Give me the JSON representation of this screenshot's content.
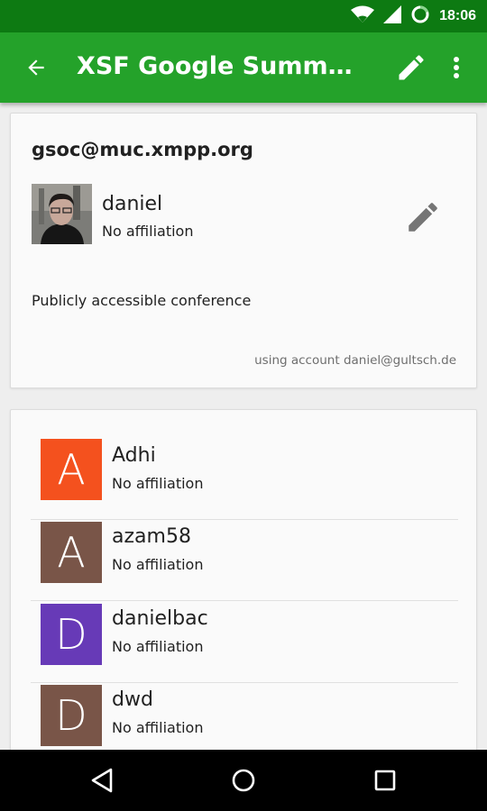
{
  "status_bar": {
    "time": "18:06",
    "icons": [
      "wifi-icon",
      "signal-icon",
      "battery-charging-icon"
    ]
  },
  "app_bar": {
    "title": "XSF Google Summer of…",
    "back_icon": "arrow-back-icon",
    "edit_icon": "pencil-icon",
    "overflow_icon": "more-vert-icon"
  },
  "conference": {
    "address": "gsoc@muc.xmpp.org",
    "self": {
      "name": "daniel",
      "affiliation": "No affiliation"
    },
    "description": "Publicly accessible conference",
    "account_note": "using account daniel@gultsch.de"
  },
  "members": [
    {
      "initial": "A",
      "name": "Adhi",
      "affiliation": "No affiliation",
      "color": "#f4511e"
    },
    {
      "initial": "A",
      "name": "azam58",
      "affiliation": "No affiliation",
      "color": "#795548"
    },
    {
      "initial": "D",
      "name": "danielbac",
      "affiliation": "No affiliation",
      "color": "#673ab7"
    },
    {
      "initial": "D",
      "name": "dwd",
      "affiliation": "No affiliation",
      "color": "#795548"
    }
  ],
  "colors": {
    "status_bar": "#0d7a12",
    "app_bar": "#24a22a",
    "background": "#eeeeee"
  },
  "nav_bar": {
    "icons": [
      "back-triangle-icon",
      "home-circle-icon",
      "recents-square-icon"
    ]
  }
}
